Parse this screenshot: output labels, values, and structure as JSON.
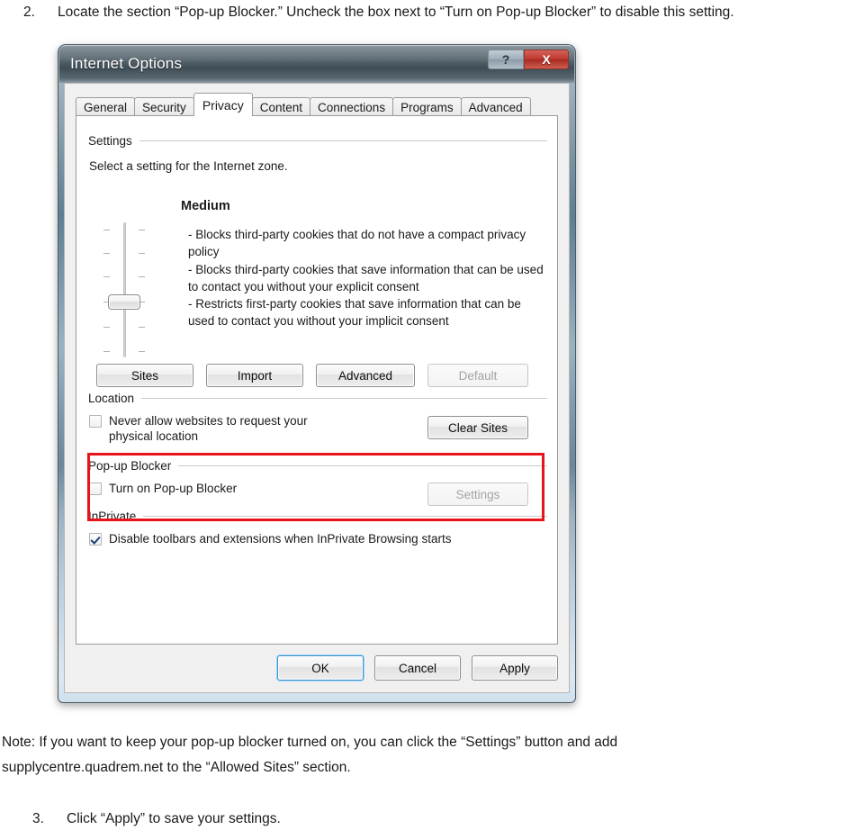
{
  "document": {
    "step2": {
      "number": "2.",
      "text": "Locate the section “Pop-up Blocker.”  Uncheck the box next to “Turn on Pop-up Blocker” to disable this setting."
    },
    "note_line1": "Note: If you want to keep your pop-up blocker turned on, you can click the “Settings” button and add",
    "note_line2": "supplycentre.quadrem.net to the “Allowed Sites” section.",
    "step3": {
      "number": "3.",
      "text": "Click “Apply” to save your settings."
    }
  },
  "dialog": {
    "title": "Internet Options",
    "titlebar": {
      "help_label": "?",
      "close_label": "X",
      "help_icon": "question-mark-icon",
      "close_icon": "close-x-icon"
    },
    "tabs": [
      {
        "label": "General",
        "active": false
      },
      {
        "label": "Security",
        "active": false
      },
      {
        "label": "Privacy",
        "active": true
      },
      {
        "label": "Content",
        "active": false
      },
      {
        "label": "Connections",
        "active": false
      },
      {
        "label": "Programs",
        "active": false
      },
      {
        "label": "Advanced",
        "active": false
      }
    ],
    "settings_group": {
      "title": "Settings",
      "instruction": "Select a setting for the Internet zone.",
      "slider": {
        "level_name": "Medium",
        "tick_count": 6,
        "thumb_position_index": 4
      },
      "level_description": "- Blocks third-party cookies that do not have a compact privacy policy\n- Blocks third-party cookies that save information that can be used to contact you without your explicit consent\n- Restricts first-party cookies that save information that can be used to contact you without your implicit consent",
      "buttons": [
        {
          "label": "Sites",
          "disabled": false
        },
        {
          "label": "Import",
          "disabled": false
        },
        {
          "label": "Advanced",
          "disabled": false
        },
        {
          "label": "Default",
          "disabled": true
        }
      ]
    },
    "location_group": {
      "title": "Location",
      "checkbox_label": "Never allow websites to request your physical location",
      "checkbox_checked": false,
      "button_label": "Clear Sites",
      "button_disabled": false
    },
    "popup_group": {
      "title": "Pop-up Blocker",
      "checkbox_label": "Turn on Pop-up Blocker",
      "checkbox_checked": false,
      "button_label": "Settings",
      "button_disabled": true
    },
    "inprivate_group": {
      "title": "InPrivate",
      "checkbox_label": "Disable toolbars and extensions when InPrivate Browsing starts",
      "checkbox_checked": true
    },
    "footer_buttons": [
      {
        "label": "OK",
        "default": true
      },
      {
        "label": "Cancel",
        "default": false
      },
      {
        "label": "Apply",
        "default": false
      }
    ]
  },
  "annotation": {
    "color": "#e8141a",
    "target": "Pop-up Blocker"
  }
}
